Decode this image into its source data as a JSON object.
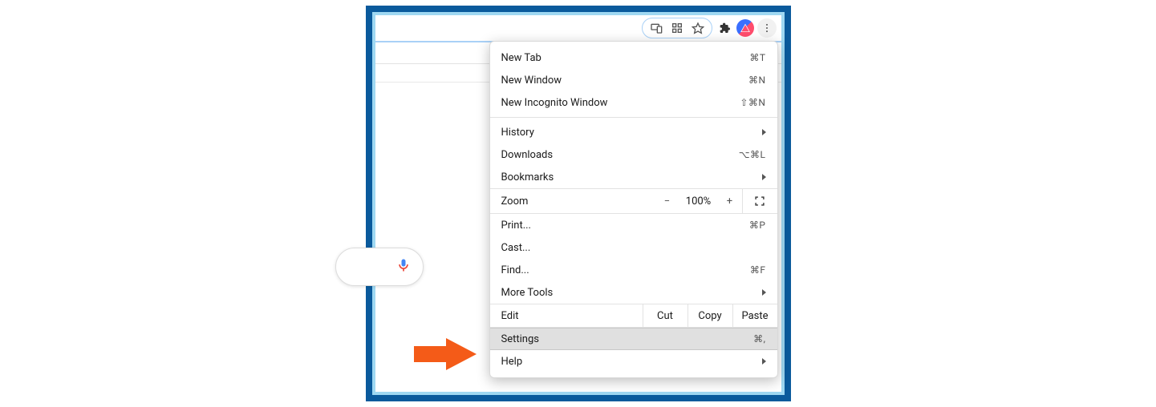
{
  "toolbar": {
    "icons": {
      "device": "device-icon",
      "grid": "grid-icon",
      "star": "star-icon",
      "puzzle": "puzzle-icon",
      "avatar": "avatar-icon",
      "more": "more-vertical-icon"
    }
  },
  "search": {
    "mic_icon": "microphone-icon"
  },
  "menu": {
    "new_tab": {
      "label": "New Tab",
      "accel": "⌘T"
    },
    "new_window": {
      "label": "New Window",
      "accel": "⌘N"
    },
    "incognito": {
      "label": "New Incognito Window",
      "accel": "⇧⌘N"
    },
    "history": {
      "label": "History"
    },
    "downloads": {
      "label": "Downloads",
      "accel": "⌥⌘L"
    },
    "bookmarks": {
      "label": "Bookmarks"
    },
    "zoom": {
      "label": "Zoom",
      "value": "100%",
      "minus": "−",
      "plus": "+"
    },
    "print": {
      "label": "Print...",
      "accel": "⌘P"
    },
    "cast": {
      "label": "Cast..."
    },
    "find": {
      "label": "Find...",
      "accel": "⌘F"
    },
    "more_tools": {
      "label": "More Tools"
    },
    "edit": {
      "label": "Edit",
      "cut": "Cut",
      "copy": "Copy",
      "paste": "Paste"
    },
    "settings": {
      "label": "Settings",
      "accel": "⌘,"
    },
    "help": {
      "label": "Help"
    }
  },
  "callout": {
    "arrow": "orange-arrow pointing to Settings"
  }
}
